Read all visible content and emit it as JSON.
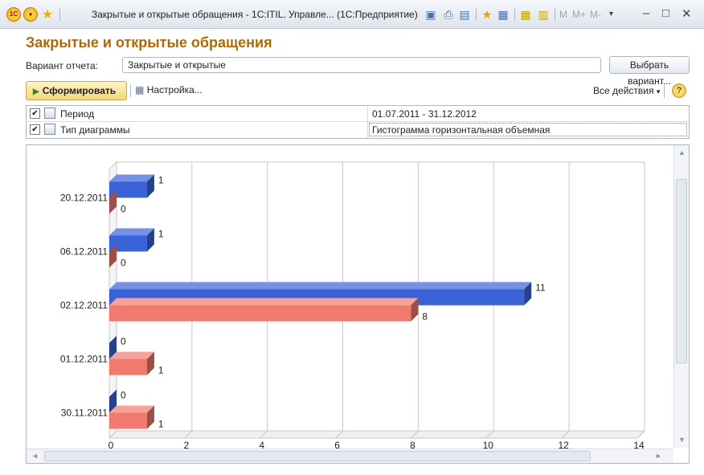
{
  "window": {
    "title": "Закрытые и открытые обращения - 1С:ITIL. Управле... (1С:Предприятие)",
    "logo_text": "1С",
    "m_buttons": [
      "M",
      "M+",
      "M-"
    ]
  },
  "report": {
    "heading": "Закрытые и открытые обращения",
    "variant_label": "Вариант отчета:",
    "variant_value": "Закрытые и открытые",
    "choose_variant_button": "Выбрать вариант...",
    "generate_button": "Сформировать",
    "settings_button": "Настройка...",
    "all_actions": "Все действия",
    "help": "?"
  },
  "parameters": [
    {
      "checked": true,
      "name": "Период",
      "value": "01.07.2011 - 31.12.2012"
    },
    {
      "checked": true,
      "name": "Тип диаграммы",
      "value": "Гистограмма горизонтальная объемная"
    }
  ],
  "colors": {
    "series_blue": "#3a62d8",
    "series_red": "#f07a6d",
    "heading": "#b06a00"
  },
  "chart_data": {
    "type": "bar",
    "orientation": "horizontal",
    "categories": [
      "20.12.2011",
      "06.12.2011",
      "02.12.2011",
      "01.12.2011",
      "30.11.2011"
    ],
    "series": [
      {
        "values": [
          1,
          1,
          11,
          0,
          0
        ],
        "color": "#3a62d8"
      },
      {
        "values": [
          0,
          0,
          8,
          1,
          1
        ],
        "color": "#f07a6d"
      }
    ],
    "xlim": [
      0,
      14
    ],
    "xticks": [
      0,
      2,
      4,
      6,
      8,
      10,
      12,
      14
    ],
    "grid": true
  }
}
